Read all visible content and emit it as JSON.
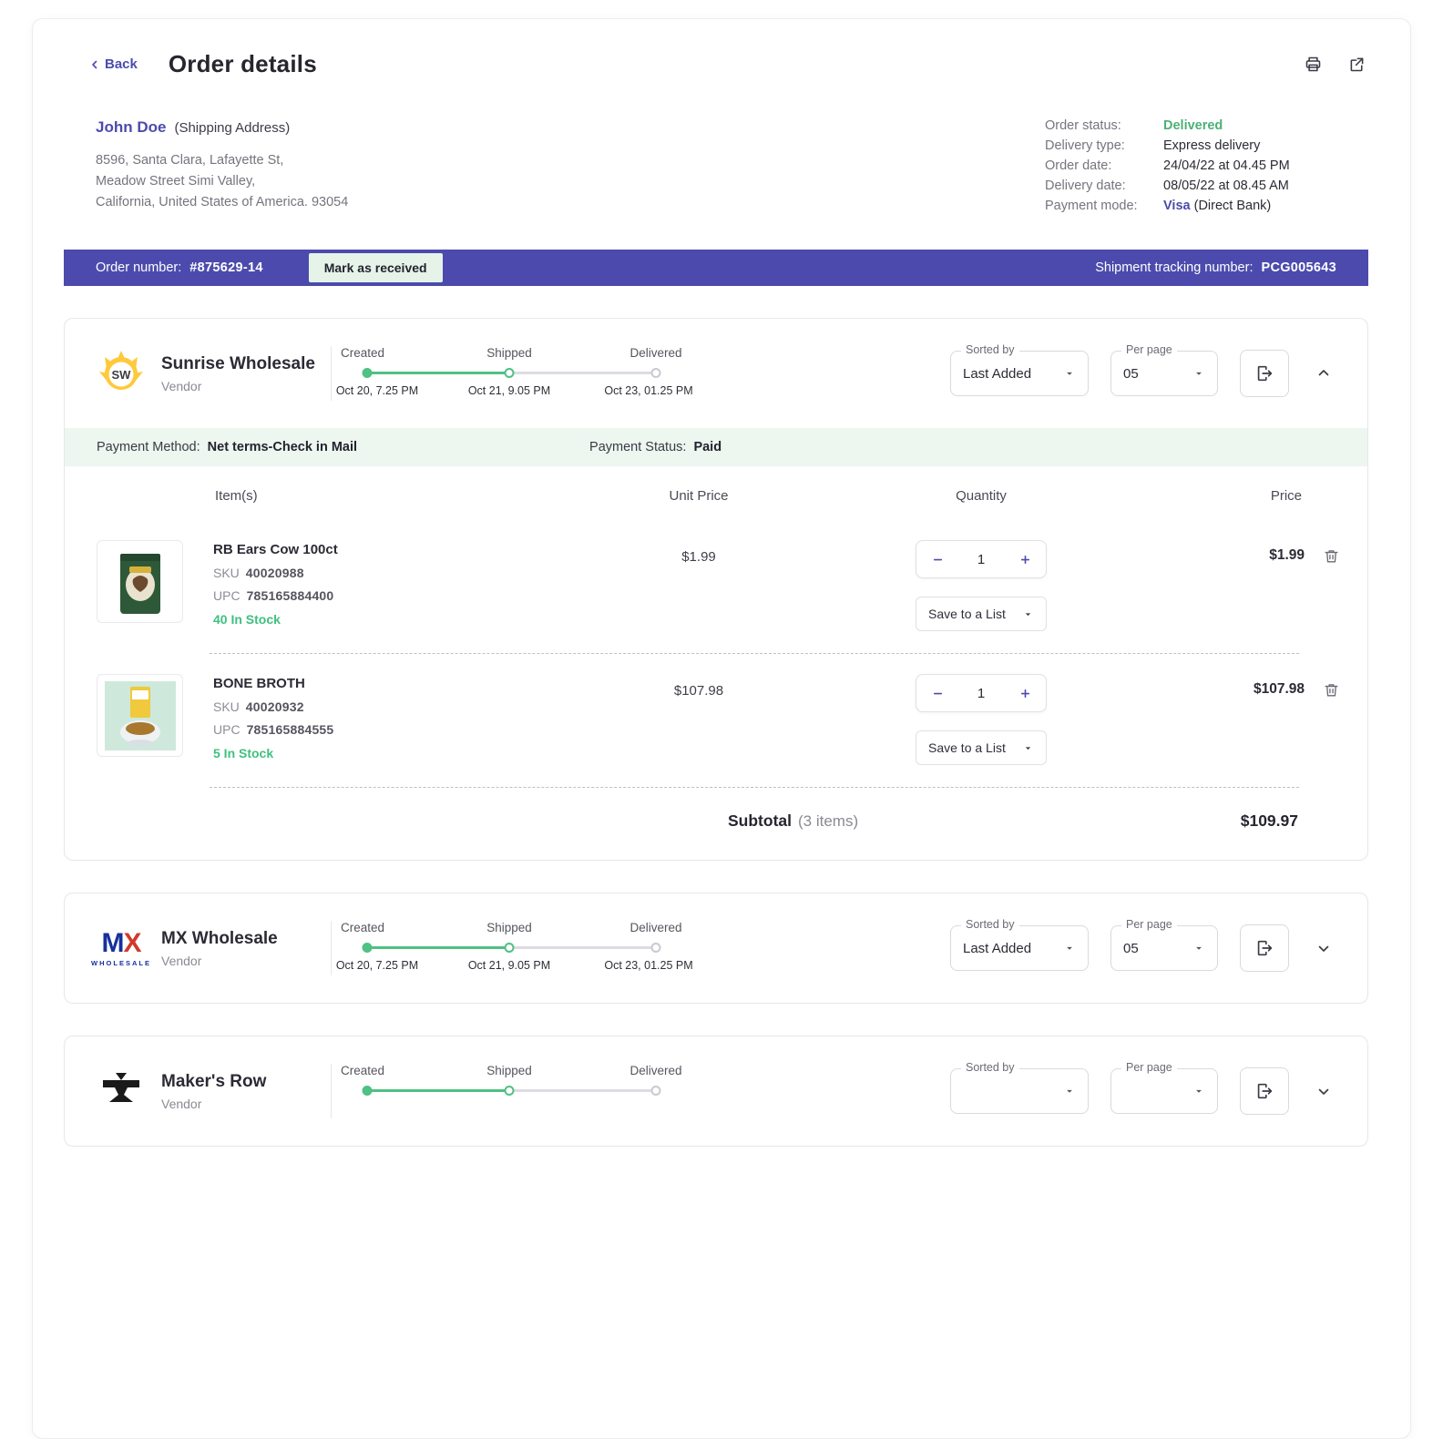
{
  "colors": {
    "accent_indigo": "#4C4BAD",
    "success_green": "#4DB075",
    "stock_green": "#3FC07F",
    "order_bar_bg": "#4C4BAD",
    "payment_strip_bg": "#EDF6EF",
    "mark_received_bg": "#E6F3E9"
  },
  "header": {
    "back": "Back",
    "title": "Order details"
  },
  "customer": {
    "name": "John Doe",
    "address_type": "(Shipping Address)",
    "address_line1": "8596, Santa Clara, Lafayette St,",
    "address_line2": "Meadow Street Simi Valley,",
    "address_line3": "California, United States of America.  93054"
  },
  "order_meta": {
    "status_label": "Order status:",
    "status_value": "Delivered",
    "delivery_type_label": "Delivery type:",
    "delivery_type_value": "Express delivery",
    "order_date_label": "Order date:",
    "order_date_value": "24/04/22 at 04.45 PM",
    "delivery_date_label": "Delivery date:",
    "delivery_date_value": "08/05/22 at 08.45 AM",
    "payment_mode_label": "Payment mode:",
    "payment_mode_link": "Visa",
    "payment_mode_rest": "(Direct Bank)"
  },
  "order_bar": {
    "number_label": "Order number:",
    "number_value": "#875629-14",
    "mark_received_button": "Mark as received",
    "tracking_label": "Shipment tracking number:",
    "tracking_value": "PCG005643"
  },
  "vendors": [
    {
      "logo_text": "SW",
      "name": "Sunrise Wholesale",
      "role": "Vendor",
      "timeline": [
        {
          "label": "Created",
          "date": "Oct 20, 7.25 PM"
        },
        {
          "label": "Shipped",
          "date": "Oct 21, 9.05 PM"
        },
        {
          "label": "Delivered",
          "date": "Oct 23, 01.25 PM"
        }
      ],
      "sorted_by_label": "Sorted by",
      "sorted_by_value": "Last Added",
      "per_page_label": "Per page",
      "per_page_value": "05",
      "payment_method_label": "Payment Method:",
      "payment_method_value": "Net terms-Check in Mail",
      "payment_status_label": "Payment Status:",
      "payment_status_value": "Paid",
      "columns": {
        "items": "Item(s)",
        "unit_price": "Unit Price",
        "quantity": "Quantity",
        "price": "Price"
      },
      "items": [
        {
          "name": "RB Ears Cow 100ct",
          "sku_label": "SKU",
          "sku": "40020988",
          "upc_label": "UPC",
          "upc": "785165884400",
          "stock": "40 In Stock",
          "unit_price": "$1.99",
          "quantity": "1",
          "save_to_list": "Save to a List",
          "price": "$1.99"
        },
        {
          "name": "BONE BROTH",
          "sku_label": "SKU",
          "sku": "40020932",
          "upc_label": "UPC",
          "upc": "785165884555",
          "stock": "5 In Stock",
          "unit_price": "$107.98",
          "quantity": "1",
          "save_to_list": "Save to a List",
          "price": "$107.98"
        }
      ],
      "subtotal_label": "Subtotal",
      "subtotal_count": "(3 items)",
      "subtotal_value": "$109.97"
    },
    {
      "logo_text": "MX",
      "logo_sub": "WHOLESALE",
      "name": "MX Wholesale",
      "role": "Vendor",
      "timeline": [
        {
          "label": "Created",
          "date": "Oct 20, 7.25 PM"
        },
        {
          "label": "Shipped",
          "date": "Oct 21, 9.05 PM"
        },
        {
          "label": "Delivered",
          "date": "Oct 23, 01.25 PM"
        }
      ],
      "sorted_by_label": "Sorted by",
      "sorted_by_value": "Last Added",
      "per_page_label": "Per page",
      "per_page_value": "05"
    },
    {
      "name": "Maker's Row",
      "role": "Vendor",
      "timeline": [
        {
          "label": "Created"
        },
        {
          "label": "Shipped"
        },
        {
          "label": "Delivered"
        }
      ],
      "sorted_by_label": "Sorted by",
      "per_page_label": "Per page"
    }
  ]
}
